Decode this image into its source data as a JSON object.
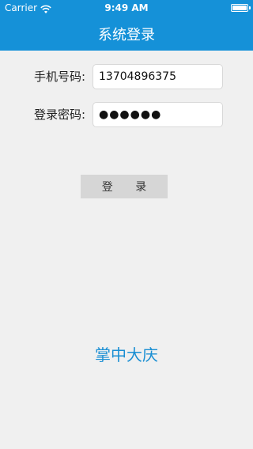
{
  "status_bar": {
    "carrier": "Carrier",
    "time": "9:49 AM",
    "wifi_icon": "wifi-icon",
    "battery_icon": "battery-icon",
    "battery_level": 1.0
  },
  "nav": {
    "title": "系统登录",
    "background": "#1591d8"
  },
  "form": {
    "phone_label": "手机号码:",
    "phone_value": "13704896375",
    "password_label": "登录密码:",
    "password_value": "●●●●●●"
  },
  "login_button": {
    "label": "登 录"
  },
  "brand": {
    "text": "掌中大庆",
    "color": "#1b8fd3"
  }
}
